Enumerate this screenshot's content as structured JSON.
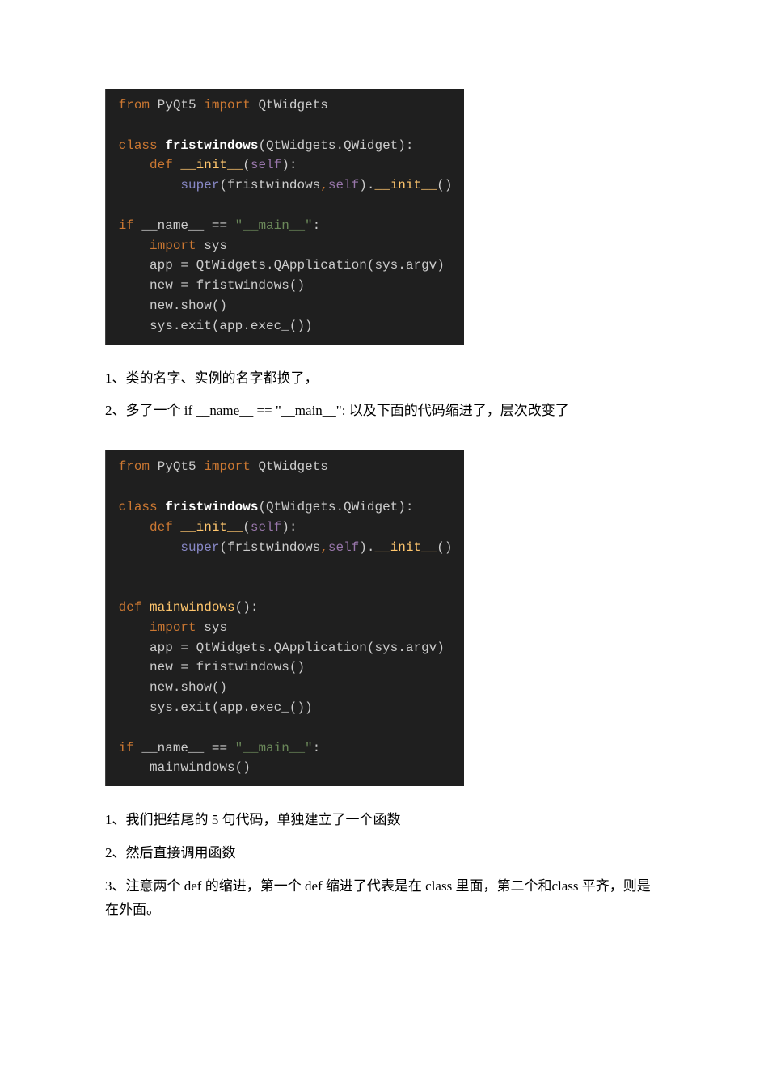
{
  "code_block_1": {
    "lines": [
      {
        "tokens": [
          {
            "cls": "kw-gutter",
            "t": " "
          },
          {
            "cls": "kw-orange",
            "t": "from "
          },
          {
            "cls": "kw-default",
            "t": "PyQt5 "
          },
          {
            "cls": "kw-orange",
            "t": "import "
          },
          {
            "cls": "kw-default",
            "t": "QtWidgets"
          }
        ]
      },
      {
        "tokens": [
          {
            "cls": "kw-default",
            "t": " "
          }
        ]
      },
      {
        "tokens": [
          {
            "cls": "kw-gutter",
            "t": " "
          },
          {
            "cls": "kw-orange",
            "t": "class "
          },
          {
            "cls": "kw-bold-white",
            "t": "fristwindows"
          },
          {
            "cls": "kw-default",
            "t": "(QtWidgets.QWidget):"
          }
        ]
      },
      {
        "tokens": [
          {
            "cls": "kw-gutter",
            "t": " "
          },
          {
            "cls": "kw-default",
            "t": "    "
          },
          {
            "cls": "kw-orange",
            "t": "def "
          },
          {
            "cls": "kw-yellow",
            "t": "__init__"
          },
          {
            "cls": "kw-default",
            "t": "("
          },
          {
            "cls": "kw-purple",
            "t": "self"
          },
          {
            "cls": "kw-default",
            "t": "):"
          }
        ]
      },
      {
        "tokens": [
          {
            "cls": "kw-gutter",
            "t": " "
          },
          {
            "cls": "kw-default",
            "t": "        "
          },
          {
            "cls": "kw-builtin",
            "t": "super"
          },
          {
            "cls": "kw-default",
            "t": "(fristwindows"
          },
          {
            "cls": "kw-orange",
            "t": ","
          },
          {
            "cls": "kw-purple",
            "t": "self"
          },
          {
            "cls": "kw-default",
            "t": ")."
          },
          {
            "cls": "kw-yellow",
            "t": "__init__"
          },
          {
            "cls": "kw-default",
            "t": "()"
          }
        ]
      },
      {
        "tokens": [
          {
            "cls": "kw-default",
            "t": " "
          }
        ]
      },
      {
        "tokens": [
          {
            "cls": "kw-gutter",
            "t": " "
          },
          {
            "cls": "kw-orange",
            "t": "if "
          },
          {
            "cls": "kw-default",
            "t": "__name__ == "
          },
          {
            "cls": "kw-green",
            "t": "\"__main__\""
          },
          {
            "cls": "kw-default",
            "t": ":"
          }
        ]
      },
      {
        "tokens": [
          {
            "cls": "kw-default",
            "t": "     "
          },
          {
            "cls": "kw-orange",
            "t": "import "
          },
          {
            "cls": "kw-default",
            "t": "sys"
          }
        ]
      },
      {
        "tokens": [
          {
            "cls": "kw-default",
            "t": "     app = QtWidgets.QApplication(sys.argv)"
          }
        ]
      },
      {
        "tokens": [
          {
            "cls": "kw-default",
            "t": "     new = fristwindows()"
          }
        ]
      },
      {
        "tokens": [
          {
            "cls": "kw-default",
            "t": "     new.show()"
          }
        ]
      },
      {
        "tokens": [
          {
            "cls": "kw-default",
            "t": "     sys.exit(app.exec_())"
          }
        ]
      }
    ]
  },
  "text_1": "1、类的名字、实例的名字都换了，",
  "text_2": "2、多了一个 if __name__ == \"__main__\": 以及下面的代码缩进了，层次改变了",
  "code_block_2": {
    "lines": [
      {
        "tokens": [
          {
            "cls": "kw-gutter",
            "t": " "
          },
          {
            "cls": "kw-orange",
            "t": "from "
          },
          {
            "cls": "kw-default",
            "t": "PyQt5 "
          },
          {
            "cls": "kw-orange",
            "t": "import "
          },
          {
            "cls": "kw-default",
            "t": "QtWidgets"
          }
        ]
      },
      {
        "tokens": [
          {
            "cls": "kw-default",
            "t": " "
          }
        ]
      },
      {
        "tokens": [
          {
            "cls": "kw-gutter",
            "t": " "
          },
          {
            "cls": "kw-orange",
            "t": "class "
          },
          {
            "cls": "kw-bold-white",
            "t": "fristwindows"
          },
          {
            "cls": "kw-default",
            "t": "(QtWidgets.QWidget):"
          }
        ]
      },
      {
        "tokens": [
          {
            "cls": "kw-gutter",
            "t": " "
          },
          {
            "cls": "kw-default",
            "t": "    "
          },
          {
            "cls": "kw-orange",
            "t": "def "
          },
          {
            "cls": "kw-yellow",
            "t": "__init__"
          },
          {
            "cls": "kw-default",
            "t": "("
          },
          {
            "cls": "kw-purple",
            "t": "self"
          },
          {
            "cls": "kw-default",
            "t": "):"
          }
        ]
      },
      {
        "tokens": [
          {
            "cls": "kw-gutter",
            "t": " "
          },
          {
            "cls": "kw-default",
            "t": "        "
          },
          {
            "cls": "kw-builtin",
            "t": "super"
          },
          {
            "cls": "kw-default",
            "t": "(fristwindows"
          },
          {
            "cls": "kw-orange",
            "t": ","
          },
          {
            "cls": "kw-purple",
            "t": "self"
          },
          {
            "cls": "kw-default",
            "t": ")."
          },
          {
            "cls": "kw-yellow",
            "t": "__init__"
          },
          {
            "cls": "kw-default",
            "t": "()"
          }
        ]
      },
      {
        "tokens": [
          {
            "cls": "kw-default",
            "t": " "
          }
        ]
      },
      {
        "tokens": [
          {
            "cls": "kw-default",
            "t": " "
          }
        ]
      },
      {
        "tokens": [
          {
            "cls": "kw-gutter",
            "t": " "
          },
          {
            "cls": "kw-orange",
            "t": "def "
          },
          {
            "cls": "kw-yellow",
            "t": "mainwindows"
          },
          {
            "cls": "kw-default",
            "t": "():"
          }
        ]
      },
      {
        "tokens": [
          {
            "cls": "kw-default",
            "t": "     "
          },
          {
            "cls": "kw-orange",
            "t": "import "
          },
          {
            "cls": "kw-default",
            "t": "sys"
          }
        ]
      },
      {
        "tokens": [
          {
            "cls": "kw-default",
            "t": "     app = QtWidgets.QApplication(sys.argv)"
          }
        ]
      },
      {
        "tokens": [
          {
            "cls": "kw-default",
            "t": "     new = fristwindows()"
          }
        ]
      },
      {
        "tokens": [
          {
            "cls": "kw-default",
            "t": "     new.show()"
          }
        ]
      },
      {
        "tokens": [
          {
            "cls": "kw-gutter",
            "t": " "
          },
          {
            "cls": "kw-default",
            "t": "    sys.exit(app.exec_())"
          }
        ]
      },
      {
        "tokens": [
          {
            "cls": "kw-default",
            "t": " "
          }
        ]
      },
      {
        "tokens": [
          {
            "cls": "kw-gutter",
            "t": " "
          },
          {
            "cls": "kw-orange",
            "t": "if "
          },
          {
            "cls": "kw-default",
            "t": "__name__ == "
          },
          {
            "cls": "kw-green",
            "t": "\"__main__\""
          },
          {
            "cls": "kw-default",
            "t": ":"
          }
        ]
      },
      {
        "tokens": [
          {
            "cls": "kw-default",
            "t": "     mainwindows()"
          }
        ]
      }
    ]
  },
  "text_3": "1、我们把结尾的 5 句代码，单独建立了一个函数",
  "text_4": "2、然后直接调用函数",
  "text_5": "3、注意两个 def 的缩进，第一个 def 缩进了代表是在 class 里面，第二个和class 平齐，则是在外面。"
}
